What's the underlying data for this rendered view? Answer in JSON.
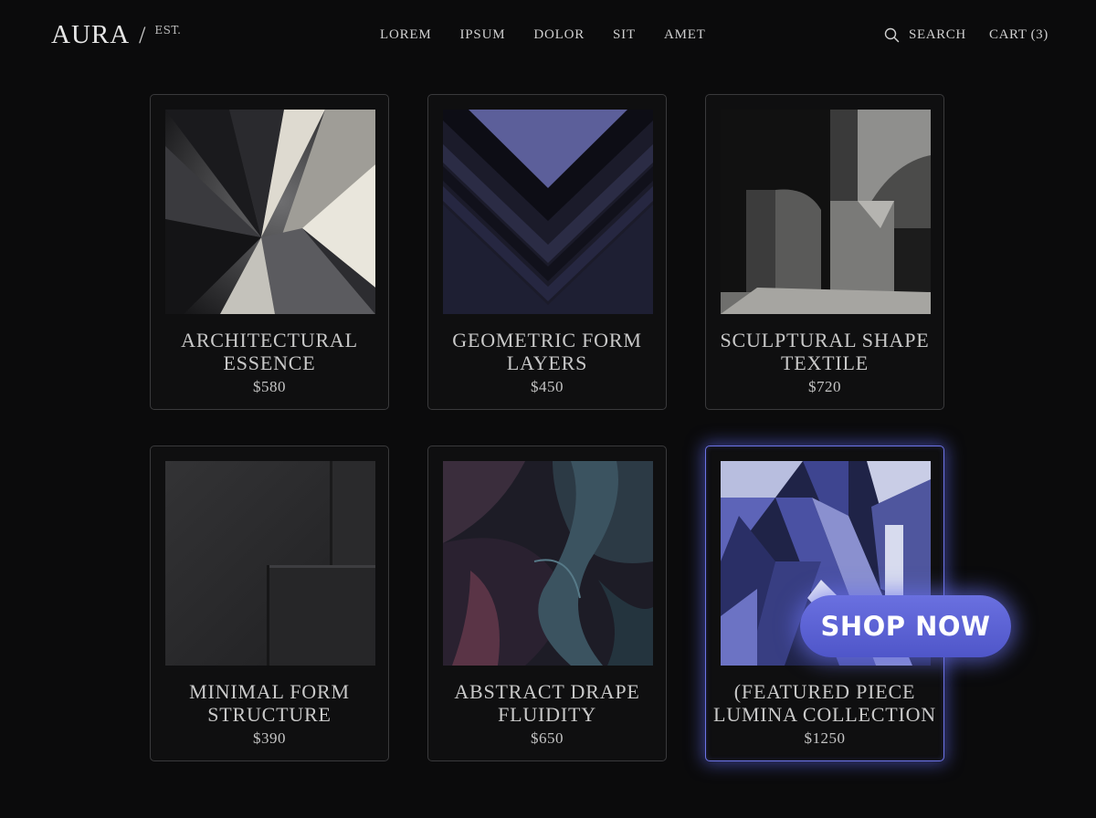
{
  "brand": {
    "name": "AURA",
    "slash": "/",
    "est": "EST."
  },
  "nav": [
    "LOREM",
    "IPSUM",
    "DOLOR",
    "SIT",
    "AMET"
  ],
  "header": {
    "search_label": "SEARCH",
    "cart_label": "CART (3)"
  },
  "products": [
    {
      "title_line1": "ARCHITECTURAL",
      "title_line2": "ESSENCE",
      "price": "$580"
    },
    {
      "title_line1": "GEOMETRIC FORM",
      "title_line2": "LAYERS",
      "price": "$450"
    },
    {
      "title_line1": "SCULPTURAL SHAPE",
      "title_line2": "TEXTILE",
      "price": "$720"
    },
    {
      "title_line1": "MINIMAL FORM",
      "title_line2": "STRUCTURE",
      "price": "$390"
    },
    {
      "title_line1": "ABSTRACT DRAPE",
      "title_line2": "FLUIDITY",
      "price": "$650"
    },
    {
      "title_line1": "(FEATURED PIECE",
      "title_line2": "LUMINA COLLECTION",
      "price": "$1250",
      "featured": true
    }
  ],
  "cta": {
    "label": "SHOP NOW"
  },
  "colors": {
    "background": "#0b0b0c",
    "accent": "#5c63d8",
    "card_border": "#3a3a3c"
  }
}
